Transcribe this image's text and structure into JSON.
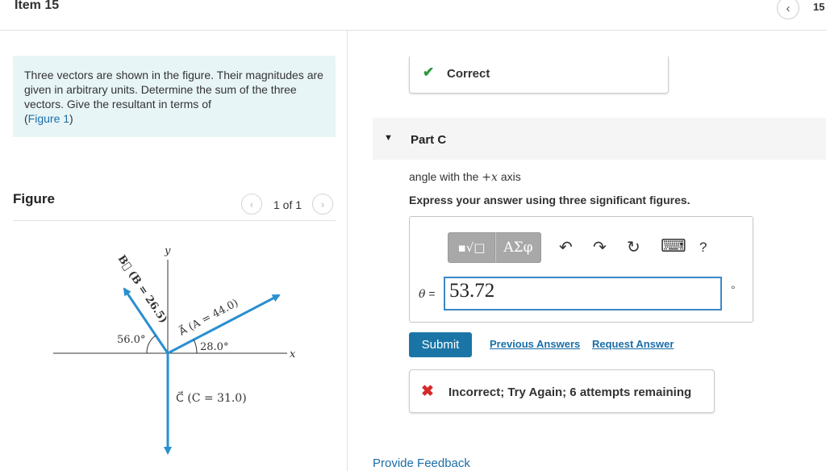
{
  "header": {
    "item_title": "Item 15",
    "page_number": "15"
  },
  "problem": {
    "text": "Three vectors are shown in the figure. Their magnitudes are given in arbitrary units. Determine the sum of the three vectors. Give the resultant in terms of",
    "figure_link": "Figure 1",
    "paren_open": "(",
    "paren_close": ")"
  },
  "figure_panel": {
    "label": "Figure",
    "counter": "1 of 1",
    "diagram": {
      "axis_x": "x",
      "axis_y": "y",
      "vector_b_label": "B⃗ (B = 26.5)",
      "vector_a_label": "A⃗ (A = 44.0)",
      "vector_c_label": "C⃗ (C = 31.0)",
      "angle_b": "56.0°",
      "angle_a": "28.0°",
      "colors": {
        "vector": "#2a8fd0",
        "axis": "#333333"
      }
    }
  },
  "previous_part": {
    "status": "Correct"
  },
  "part": {
    "title": "Part C",
    "question_prefix": "angle with the",
    "question_math": "+x",
    "question_suffix": "axis",
    "instruction": "Express your answer using three significant figures.",
    "toolbar": {
      "templates_label": "▪√□",
      "symbols_label": "ΑΣφ",
      "undo": "↶",
      "redo": "↷",
      "reset": "↻",
      "keyboard": "⌨",
      "help": "?"
    },
    "variable": "θ",
    "equals": "=",
    "answer_value": "53.72",
    "unit": "°",
    "submit_label": "Submit",
    "previous_answers_label": "Previous Answers",
    "request_answer_label": "Request Answer",
    "feedback": "Incorrect; Try Again; 6 attempts remaining"
  },
  "footer": {
    "provide_feedback": "Provide Feedback"
  }
}
